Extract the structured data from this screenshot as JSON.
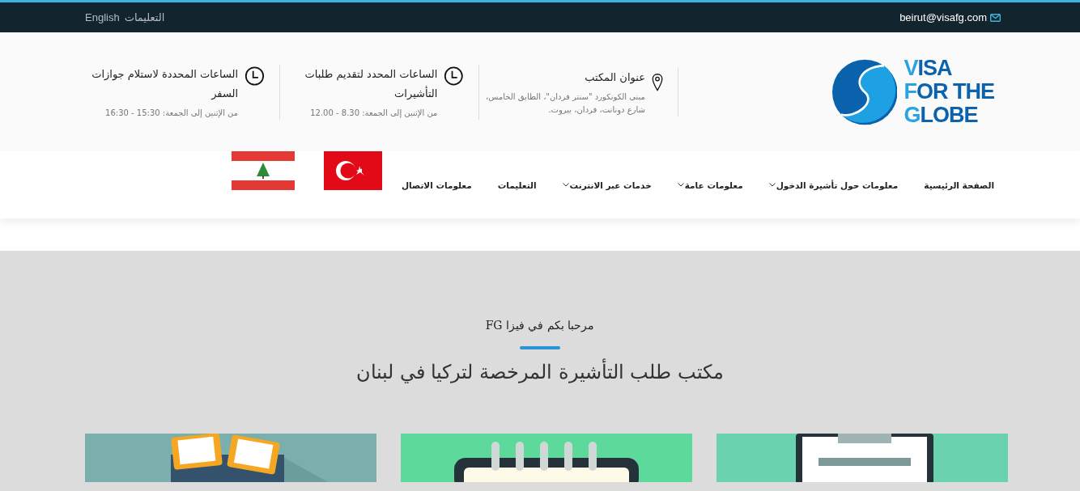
{
  "top_bar": {
    "email": "beirut@visafg.com",
    "links": [
      {
        "label": "التعليمات"
      },
      {
        "label": "English"
      }
    ]
  },
  "header": {
    "logo": {
      "lines": [
        "VISA",
        "FOR THE",
        "GLOBE"
      ]
    },
    "info": [
      {
        "kind": "location",
        "title": "عنوان المكتب",
        "text": "مبنى الكونكورد \"سنتر فردان\"، الطابق الخامس، شارع دونانت، فردان، بيروت."
      },
      {
        "kind": "clock",
        "title": "الساعات المحدد لتقديم طلبات التأشيرات",
        "text": "من الإثنين إلى الجمعة: 8.30 - 12.00"
      },
      {
        "kind": "clock",
        "title": "الساعات المحددة لاستلام جوازات السفر",
        "text": "من الإثنين إلى الجمعة: 15:30 - 16:30"
      }
    ]
  },
  "nav": {
    "items": [
      {
        "label": "الصفحة الرئيسية",
        "dropdown": false
      },
      {
        "label": "معلومات حول تأشيرة الدخول",
        "dropdown": true
      },
      {
        "label": "معلومات عامة",
        "dropdown": true
      },
      {
        "label": "خدمات عبر الانترنت",
        "dropdown": true
      },
      {
        "label": "التعليمات",
        "dropdown": false
      },
      {
        "label": "معلومات الاتصال",
        "dropdown": false
      }
    ],
    "flags": [
      {
        "kind": "turkey"
      },
      {
        "kind": "lebanon"
      }
    ]
  },
  "hero": {
    "subtitle": "مرحبا بكم في فيزا FG",
    "title": "مكتب طلب التأشيرة المرخصة لتركيا في لبنان"
  }
}
